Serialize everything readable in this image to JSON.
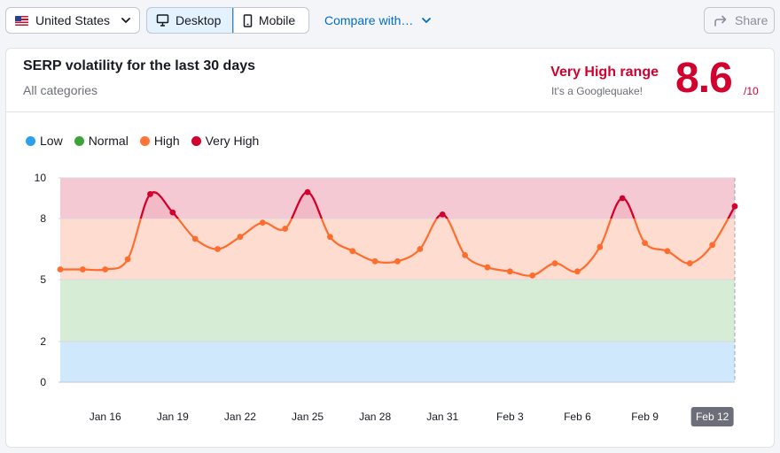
{
  "toolbar": {
    "country": "United States",
    "desktop_label": "Desktop",
    "mobile_label": "Mobile",
    "compare_label": "Compare with…",
    "share_label": "Share"
  },
  "card": {
    "title": "SERP volatility for the last 30 days",
    "subtitle": "All categories",
    "range_label": "Very High range",
    "range_note": "It's a Googlequake!",
    "score": "8.6",
    "score_max": "/10"
  },
  "colors": {
    "low": "#2b9ff0",
    "normal": "#3ca33a",
    "high": "#ff7438",
    "very_high": "#d1002f"
  },
  "chart_data": {
    "type": "area",
    "legend": [
      {
        "name": "Low",
        "color": "#2b9ff0"
      },
      {
        "name": "Normal",
        "color": "#3ca33a"
      },
      {
        "name": "High",
        "color": "#ff7438"
      },
      {
        "name": "Very High",
        "color": "#d1002f"
      }
    ],
    "bands": [
      {
        "name": "Low",
        "from": 0,
        "to": 2,
        "color": "#cfe8fc"
      },
      {
        "name": "Normal",
        "from": 2,
        "to": 5,
        "color": "#d7ecd4"
      },
      {
        "name": "High",
        "from": 5,
        "to": 8,
        "color": "#ffdcd0"
      },
      {
        "name": "Very High",
        "from": 8,
        "to": 10,
        "color": "#f5c9d3"
      }
    ],
    "y_ticks": [
      0,
      2,
      5,
      8,
      10
    ],
    "ylim": [
      0,
      10
    ],
    "x_ticks": [
      "Jan 16",
      "Jan 19",
      "Jan 22",
      "Jan 25",
      "Jan 28",
      "Jan 31",
      "Feb 3",
      "Feb 6",
      "Feb 9",
      "Feb 12"
    ],
    "x_tick_index": [
      2,
      5,
      8,
      11,
      14,
      17,
      20,
      23,
      26,
      29
    ],
    "highlight_label": "Feb 12",
    "series": [
      {
        "values": [
          5.5,
          5.5,
          5.5,
          6.0,
          9.2,
          8.3,
          7.0,
          6.5,
          7.1,
          7.8,
          7.5,
          9.3,
          7.1,
          6.4,
          5.9,
          5.9,
          6.5,
          8.2,
          6.2,
          5.6,
          5.4,
          5.2,
          5.8,
          5.4,
          6.6,
          9.0,
          6.8,
          6.4,
          5.8,
          6.7,
          8.6
        ]
      }
    ]
  }
}
